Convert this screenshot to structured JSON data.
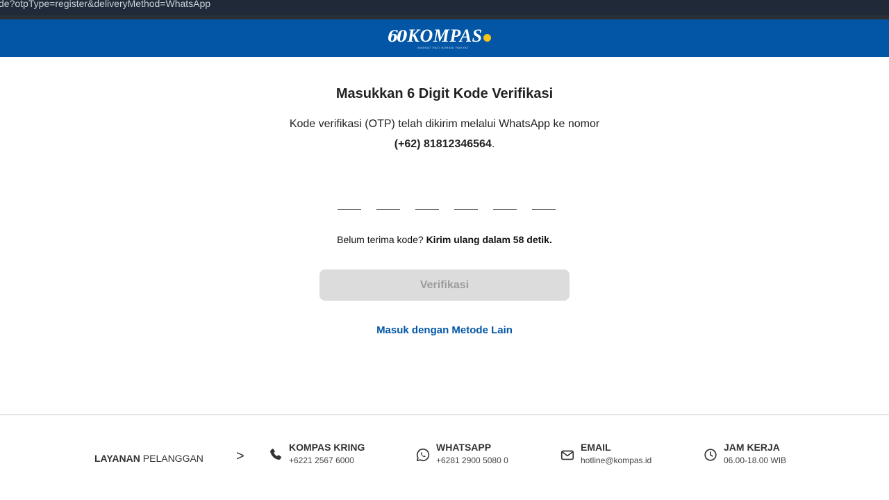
{
  "browser": {
    "url_text": "de?otpType=register&deliveryMethod=WhatsApp"
  },
  "brand": {
    "logo_number": "60",
    "logo_name": "KOMPAS",
    "logo_tagline": "AMANAT HATI NURANI RAKYAT",
    "bar_color": "#0356a5"
  },
  "main": {
    "title": "Masukkan 6 Digit Kode Verifikasi",
    "description": "Kode verifikasi (OTP) telah dikirim melalui WhatsApp ke nomor",
    "phone": "(+62) 81812346564",
    "phone_suffix": ".",
    "otp_digits": [
      "",
      "",
      "",
      "",
      "",
      ""
    ],
    "resend_prefix": "Belum terima kode?",
    "resend_countdown": "Kirim ulang dalam 58 detik.",
    "verify_button": "Verifikasi",
    "other_method_link": "Masuk dengan Metode Lain"
  },
  "footer": {
    "service_bold": "LAYANAN",
    "service_rest": "PELANGGAN",
    "chevron": ">",
    "items": [
      {
        "icon": "phone-icon",
        "title": "KOMPAS KRING",
        "value": "+6221 2567 6000"
      },
      {
        "icon": "whatsapp-icon",
        "title": "WHATSAPP",
        "value": "+6281 2900 5080 0"
      },
      {
        "icon": "mail-icon",
        "title": "EMAIL",
        "value": "hotline@kompas.id"
      },
      {
        "icon": "clock-icon",
        "title": "JAM KERJA",
        "value": "06.00-18.00 WIB"
      }
    ]
  }
}
